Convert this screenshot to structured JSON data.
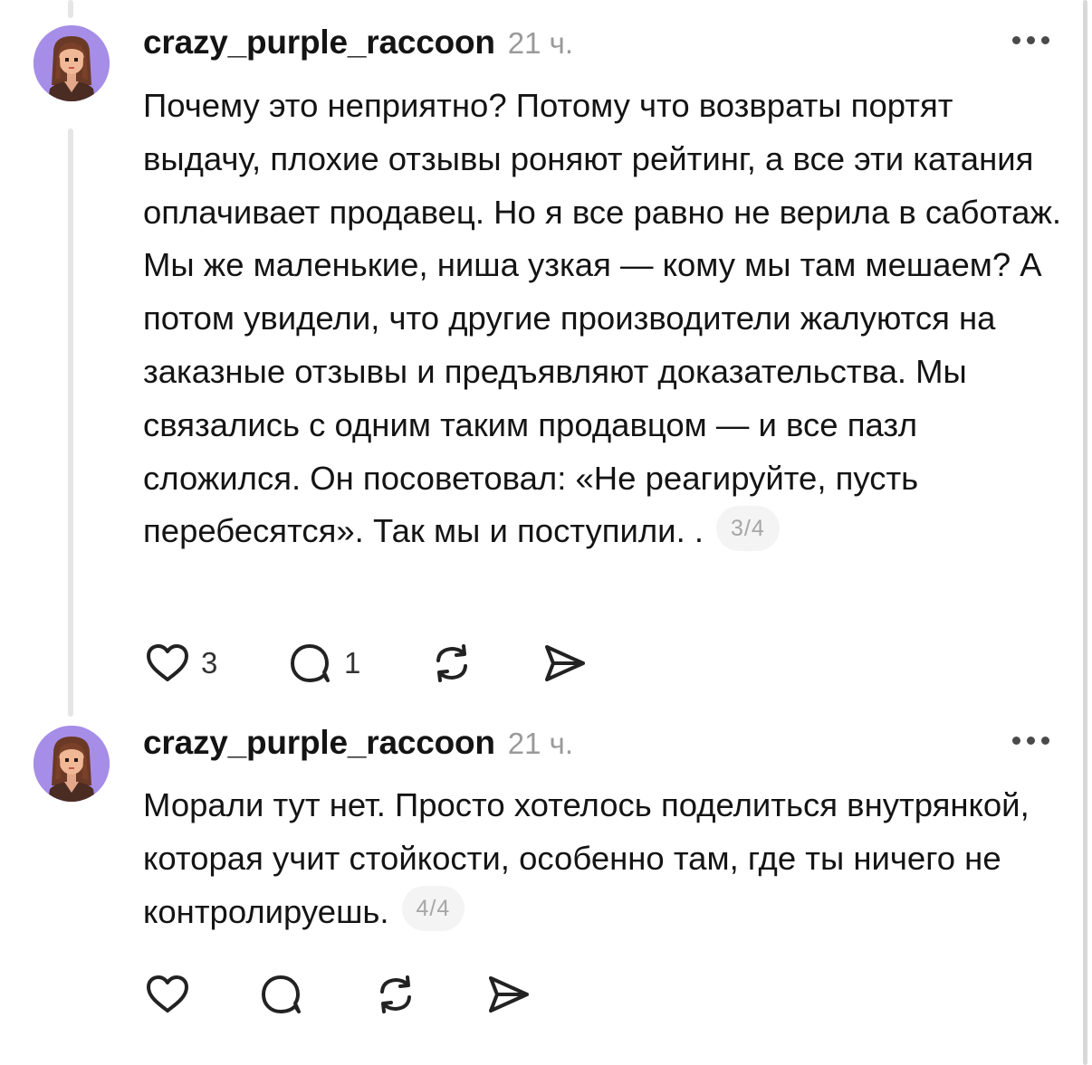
{
  "posts": [
    {
      "username": "crazy_purple_raccoon",
      "time": "21 ч.",
      "text": "Почему это неприятно? Потому что возвраты портят выдачу, плохие отзывы роняют рейтинг, а все эти катания оплачивает продавец. Но я все равно не верила в саботаж. Мы же маленькие, ниша узкая — кому мы там мешаем? А потом увидели, что другие производители жалуются на заказные отзывы и предъявляют доказательства. Мы связались с одним таким продавцом — и все пазл сложился. Он посоветовал: «Не реагируйте, пусть перебесятся». Так мы и поступили. .",
      "counter": "3/4",
      "likes": "3",
      "replies": "1",
      "icons": [
        "heart-icon",
        "comment-icon",
        "repost-icon",
        "share-icon"
      ]
    },
    {
      "username": "crazy_purple_raccoon",
      "time": "21 ч.",
      "text": "Морали тут нет. Просто хотелось поделиться внутрянкой, которая учит стойкости, особенно там, где ты ничего не контролируешь.",
      "counter": "4/4",
      "likes": "",
      "replies": "",
      "icons": [
        "heart-icon",
        "comment-icon",
        "repost-icon",
        "share-icon"
      ]
    }
  ],
  "colors": {
    "avatar_bg": "#a68de8",
    "text": "#141414",
    "muted": "#9a9a9a",
    "thread_line": "#e6e6e6",
    "badge_bg": "#f4f4f4"
  }
}
